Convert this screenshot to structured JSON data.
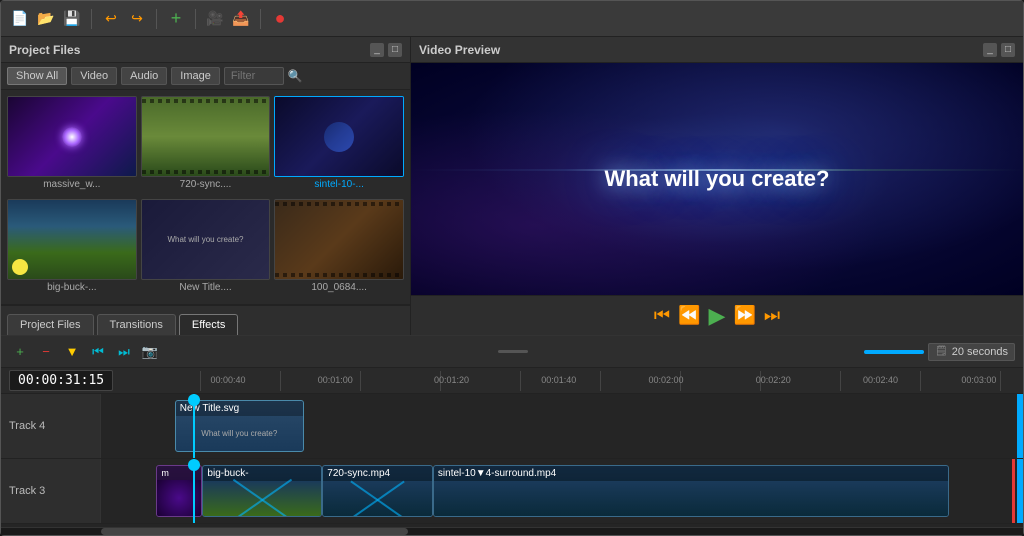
{
  "toolbar": {
    "buttons": [
      "new",
      "open",
      "save",
      "undo",
      "redo",
      "add-clip",
      "capture",
      "render"
    ]
  },
  "project_files": {
    "title": "Project Files",
    "filter_tabs": [
      "Show All",
      "Video",
      "Audio",
      "Image"
    ],
    "filter_placeholder": "Filter",
    "media_items": [
      {
        "id": "massive_w",
        "label": "massive_w...",
        "type": "video",
        "thumb": "galaxy"
      },
      {
        "id": "720-sync",
        "label": "720-sync....",
        "type": "video",
        "thumb": "outdoor"
      },
      {
        "id": "sintel-10",
        "label": "sintel-10-...",
        "type": "video",
        "thumb": "space",
        "selected": true
      },
      {
        "id": "big-buck",
        "label": "big-buck-...",
        "type": "video",
        "thumb": "bunny"
      },
      {
        "id": "new-title",
        "label": "New Title....",
        "type": "title",
        "thumb": "title"
      },
      {
        "id": "100_0684",
        "label": "100_0684....",
        "type": "video",
        "thumb": "sintel"
      }
    ]
  },
  "tabs": {
    "items": [
      "Project Files",
      "Transitions",
      "Effects"
    ],
    "active": "Effects"
  },
  "video_preview": {
    "title": "Video Preview",
    "overlay_text": "What will you create?"
  },
  "preview_controls": {
    "buttons": [
      "rewind-start",
      "rewind",
      "play",
      "forward",
      "forward-end"
    ]
  },
  "timeline": {
    "toolbar_buttons": [
      "add-track-green",
      "remove-track-red",
      "arrow-down-yellow",
      "go-start",
      "go-end",
      "snapshot"
    ],
    "zoom_label": "20 seconds",
    "timecode": "00:00:31:15",
    "ruler_marks": [
      "00:00:40",
      "00:01:00",
      "00:01:20",
      "00:01:40",
      "00:02:00",
      "00:02:20",
      "00:02:40",
      "00:03:00"
    ],
    "tracks": [
      {
        "id": "track4",
        "label": "Track 4",
        "clips": [
          {
            "id": "new-title-svg",
            "label": "New Title.svg",
            "color": "#2a4a6a",
            "start_pct": 8,
            "width_pct": 14
          }
        ]
      },
      {
        "id": "track3",
        "label": "Track 3",
        "clips": [
          {
            "id": "massive-clip",
            "label": "m...",
            "color": "#1a3a1a",
            "start_pct": 7,
            "width_pct": 5
          },
          {
            "id": "big-buck-clip",
            "label": "big-buck-",
            "color": "#1a3a5a",
            "start_pct": 12,
            "width_pct": 14
          },
          {
            "id": "720-sync-clip",
            "label": "720-sync.mp4",
            "color": "#1a3a5a",
            "start_pct": 26,
            "width_pct": 12
          },
          {
            "id": "sintel-clip",
            "label": "sintel-10▼4-surround.mp4",
            "color": "#1a3a5a",
            "start_pct": 38,
            "width_pct": 55
          }
        ]
      }
    ],
    "playhead_pct": 10
  }
}
